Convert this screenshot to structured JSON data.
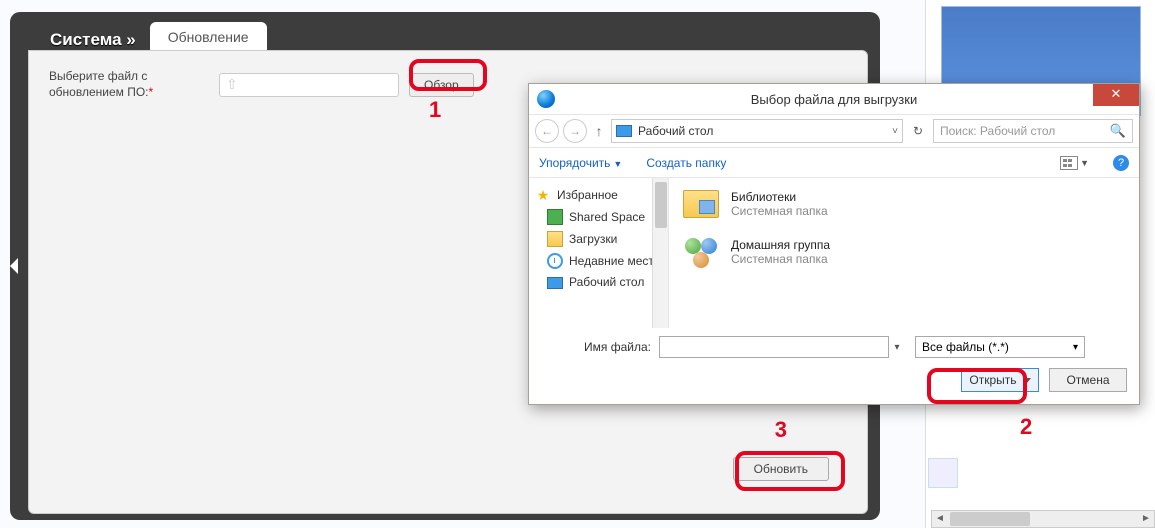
{
  "page": {
    "breadcrumb": "Система »",
    "tab": "Обновление",
    "form_label": "Выберите файл с обновлением ПО:",
    "required_mark": "*",
    "browse_label": "Обзор",
    "update_label": "Обновить",
    "marker1": "1",
    "marker2": "2",
    "marker3": "3"
  },
  "dialog": {
    "title": "Выбор файла для выгрузки",
    "close": "✕",
    "nav_back": "←",
    "nav_fwd": "→",
    "nav_up": "↑",
    "path_label": "Рабочий стол",
    "path_drop": "˅",
    "refresh": "↻",
    "search_placeholder": "Поиск: Рабочий стол",
    "search_icon": "🔍",
    "organize": "Упорядочить",
    "new_folder": "Создать папку",
    "help": "?",
    "tree": [
      {
        "label": "Избранное",
        "icon": "star"
      },
      {
        "label": "Shared Space",
        "icon": "green"
      },
      {
        "label": "Загрузки",
        "icon": "folder"
      },
      {
        "label": "Недавние места",
        "icon": "clock"
      },
      {
        "label": "Рабочий стол",
        "icon": "desktop"
      }
    ],
    "files": [
      {
        "name": "Библиотеки",
        "type": "Системная папка",
        "icon": "lib"
      },
      {
        "name": "Домашняя группа",
        "type": "Системная папка",
        "icon": "home"
      }
    ],
    "filename_label": "Имя файла:",
    "filename_value": "",
    "filetype_label": "Все файлы (*.*)",
    "open_label": "Открыть",
    "cancel_label": "Отмена"
  }
}
